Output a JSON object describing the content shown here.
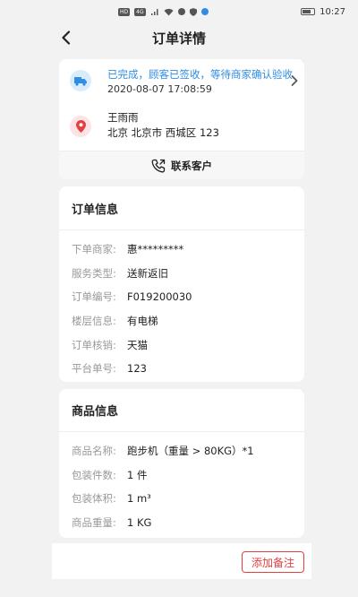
{
  "status_bar": {
    "network_label": "HD",
    "signal_label": "4G",
    "time": "10:27"
  },
  "navbar": {
    "title": "订单详情",
    "back_icon": "arrow-left-icon"
  },
  "order_status": {
    "status_text": "已完成，顾客已签收，等待商家确认验收",
    "timestamp": "2020-08-07 17:08:59",
    "icon": "truck-icon",
    "icon_color": "#2f8de4",
    "status_color": "#2f8de4"
  },
  "address": {
    "name": "王雨雨",
    "detail": "北京 北京市 西城区 123",
    "icon": "location-pin-icon",
    "icon_color": "#e34040"
  },
  "contact": {
    "label": "联系客户",
    "icon": "phone-icon"
  },
  "order_info": {
    "title": "订单信息",
    "rows": [
      {
        "label": "下单商家:",
        "value": "惠*********"
      },
      {
        "label": "服务类型:",
        "value": "送新返旧"
      },
      {
        "label": "订单编号:",
        "value": "F019200030"
      },
      {
        "label": "楼层信息:",
        "value": "有电梯"
      },
      {
        "label": "订单核销:",
        "value": "天猫"
      },
      {
        "label": "平台单号:",
        "value": "123"
      }
    ]
  },
  "goods_info": {
    "title": "商品信息",
    "rows": [
      {
        "label": "商品名称:",
        "value": "跑步机（重量 > 80KG）*1"
      },
      {
        "label": "包装件数:",
        "value": "1  件"
      },
      {
        "label": "包装体积:",
        "value": "1  m³"
      },
      {
        "label": "商品重量:",
        "value": "1  KG"
      }
    ]
  },
  "footer": {
    "add_note_label": "添加备注",
    "accent_color": "#e34040"
  }
}
